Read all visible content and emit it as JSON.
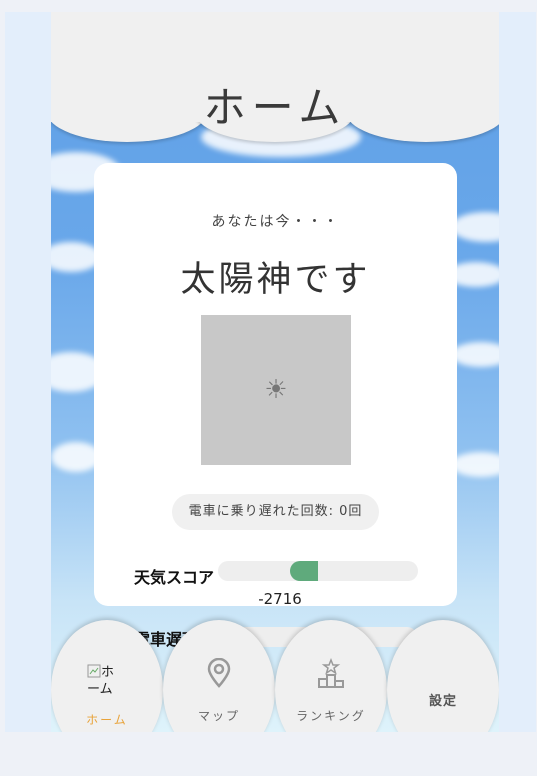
{
  "header": {
    "title": "ホーム"
  },
  "status_card": {
    "intro": "あなたは今・・・",
    "status": "太陽神です",
    "image_alt_icon": "sun-icon",
    "missed_train": "電車に乗り遅れた回数: 0回"
  },
  "scores": {
    "weather": {
      "label": "天気スコア",
      "value": "-2716",
      "fill_fraction": 0.14
    },
    "train_delay": {
      "label": "電車遅延率"
    }
  },
  "nav": {
    "home": {
      "label": "ホーム",
      "icon_alt": "ホーム",
      "active": true,
      "color": "#e8a33a"
    },
    "map": {
      "label": "マップ",
      "icon": "map-pin-icon"
    },
    "ranking": {
      "label": "ランキング",
      "icon": "podium-icon"
    },
    "settings": {
      "label": "設定"
    }
  }
}
